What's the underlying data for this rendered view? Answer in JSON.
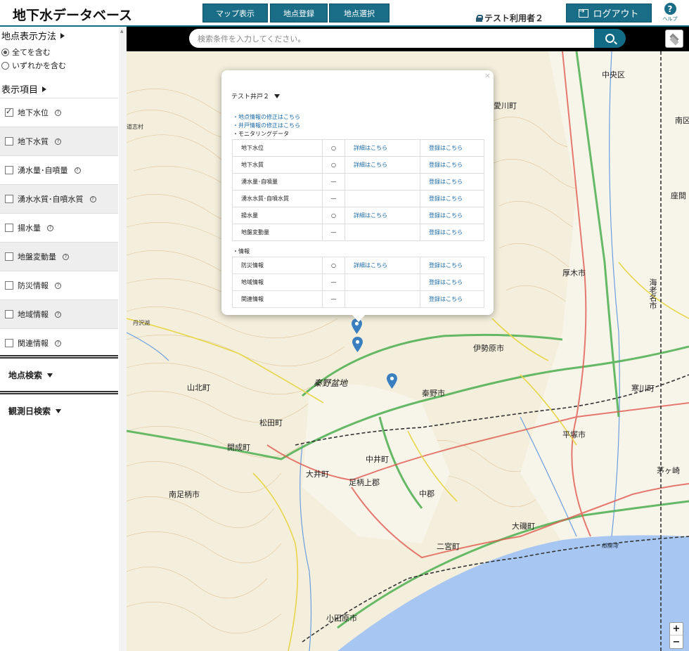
{
  "header": {
    "title": "地下水データベース",
    "nav": [
      "マップ表示",
      "地点登録",
      "地点選択"
    ],
    "user": "テスト利用者２",
    "logout": "ログアウト",
    "help": "ヘルプ"
  },
  "sidebar": {
    "display_method": "地点表示方法",
    "radio_all": "全てを含む",
    "radio_any": "いずれかを含む",
    "display_items": "表示項目",
    "items": [
      {
        "label": "地下水位",
        "checked": true
      },
      {
        "label": "地下水質",
        "checked": false
      },
      {
        "label": "湧水量･自噴量",
        "checked": false
      },
      {
        "label": "湧水水質･自噴水質",
        "checked": false
      },
      {
        "label": "揚水量",
        "checked": false
      },
      {
        "label": "地盤変動量",
        "checked": false
      },
      {
        "label": "防災情報",
        "checked": false
      },
      {
        "label": "地域情報",
        "checked": false
      },
      {
        "label": "関連情報",
        "checked": false
      }
    ],
    "point_search": "地点検索",
    "date_search": "観測日検索"
  },
  "search": {
    "placeholder": "検索条件を入力してください。"
  },
  "popup": {
    "title": "テスト井戸２",
    "close": "×",
    "link_point": "・地点情報の修正はこちら",
    "link_well": "・井戸情報の修正はこちら",
    "monitoring": "・モニタリングデータ",
    "monitoring_rows": [
      {
        "name": "地下水位",
        "has": "○",
        "detail": "詳細はこちら",
        "reg": "登録はこちら"
      },
      {
        "name": "地下水質",
        "has": "○",
        "detail": "詳細はこちら",
        "reg": "登録はこちら"
      },
      {
        "name": "湧水量･自噴量",
        "has": "—",
        "detail": "",
        "reg": "登録はこちら"
      },
      {
        "name": "湧水水質･自噴水質",
        "has": "—",
        "detail": "",
        "reg": "登録はこちら"
      },
      {
        "name": "揚水量",
        "has": "○",
        "detail": "詳細はこちら",
        "reg": "登録はこちら"
      },
      {
        "name": "地盤変動量",
        "has": "—",
        "detail": "",
        "reg": "登録はこちら"
      }
    ],
    "info": "・情報",
    "info_rows": [
      {
        "name": "防災情報",
        "has": "○",
        "detail": "詳細はこちら",
        "reg": "登録はこちら"
      },
      {
        "name": "地域情報",
        "has": "—",
        "detail": "",
        "reg": "登録はこちら"
      },
      {
        "name": "関連情報",
        "has": "—",
        "detail": "",
        "reg": "登録はこちら"
      }
    ]
  },
  "map": {
    "labels": [
      "中央区",
      "南区",
      "愛川町",
      "座間",
      "厚木市",
      "海老名市",
      "伊勢原市",
      "秦野盆地",
      "秦野市",
      "寒川町",
      "平塚市",
      "茅ヶ崎",
      "山北町",
      "松田町",
      "開成町",
      "大井町",
      "中井町",
      "足柄上郡",
      "南足柄市",
      "中郡",
      "大磯町",
      "二宮町",
      "小田原市",
      "道志村",
      "丹沢湖",
      "相模湾"
    ],
    "zoom_in": "+",
    "zoom_out": "−"
  }
}
